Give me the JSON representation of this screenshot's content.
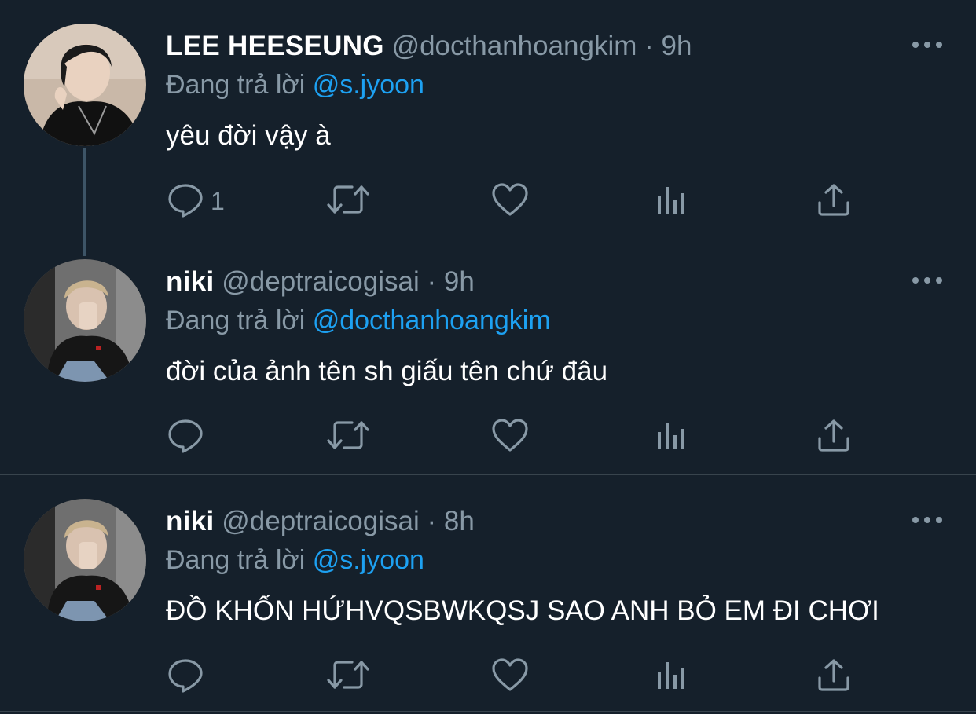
{
  "tweets": [
    {
      "name": "LEE HEESEUNG",
      "handle": "@docthanhoangkim",
      "separator": "·",
      "time": "9h",
      "reply_prefix": "Đang trả lời",
      "reply_to": "@s.jyoon",
      "text": "yêu đời vậy à",
      "reply_count": "1"
    },
    {
      "name": "niki",
      "handle": "@deptraicogisai",
      "separator": "·",
      "time": "9h",
      "reply_prefix": "Đang trả lời",
      "reply_to": "@docthanhoangkim",
      "text": "đời của ảnh tên sh giấu tên chứ đâu",
      "reply_count": ""
    },
    {
      "name": "niki",
      "handle": "@deptraicogisai",
      "separator": "·",
      "time": "8h",
      "reply_prefix": "Đang trả lời",
      "reply_to": "@s.jyoon",
      "text": "ĐỒ KHỐN HỨHVQSBWKQSJ SAO ANH BỎ EM ĐI CHƠI",
      "reply_count": ""
    }
  ],
  "icons": {
    "reply": "reply-icon",
    "retweet": "retweet-icon",
    "like": "heart-icon",
    "stats": "analytics-icon",
    "share": "share-icon",
    "more": "more-icon"
  },
  "colors": {
    "background": "#15202b",
    "muted": "#8899a6",
    "link": "#1da1f2",
    "divider": "#38444d"
  }
}
